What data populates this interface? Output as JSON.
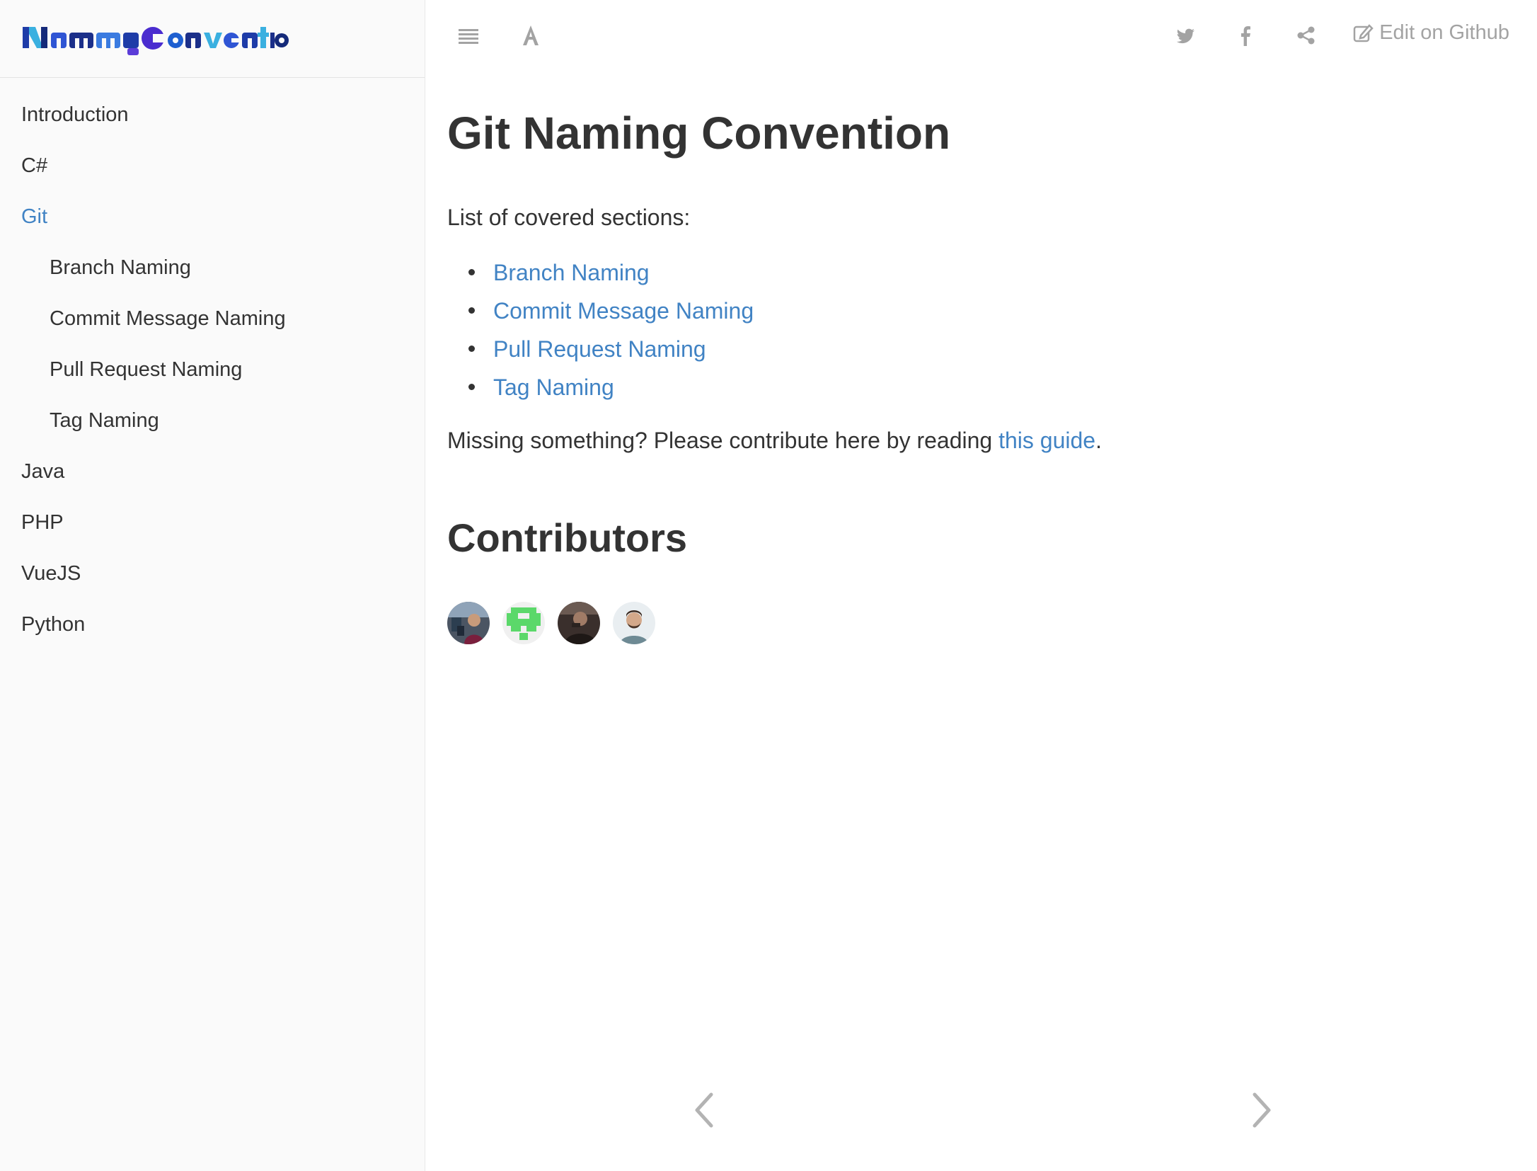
{
  "logo": {
    "text": "NamingConvention"
  },
  "sidebar": {
    "items": [
      {
        "label": "Introduction",
        "level": 0,
        "active": false
      },
      {
        "label": "C#",
        "level": 0,
        "active": false
      },
      {
        "label": "Git",
        "level": 0,
        "active": true
      },
      {
        "label": "Branch Naming",
        "level": 1,
        "active": false
      },
      {
        "label": "Commit Message Naming",
        "level": 1,
        "active": false
      },
      {
        "label": "Pull Request Naming",
        "level": 1,
        "active": false
      },
      {
        "label": "Tag Naming",
        "level": 1,
        "active": false
      },
      {
        "label": "Java",
        "level": 0,
        "active": false
      },
      {
        "label": "PHP",
        "level": 0,
        "active": false
      },
      {
        "label": "VueJS",
        "level": 0,
        "active": false
      },
      {
        "label": "Python",
        "level": 0,
        "active": false
      }
    ]
  },
  "header": {
    "icons": [
      "menu-icon",
      "font-settings-icon",
      "twitter-icon",
      "facebook-icon",
      "share-icon"
    ],
    "edit_label": "Edit on Github"
  },
  "main": {
    "title": "Git Naming Convention",
    "intro": "List of covered sections:",
    "sections": [
      "Branch Naming",
      "Commit Message Naming",
      "Pull Request Naming",
      "Tag Naming"
    ],
    "missing_prefix": "Missing something? Please contribute here by reading ",
    "missing_link": "this guide",
    "missing_suffix": ".",
    "contributors_title": "Contributors"
  },
  "colors": {
    "link": "#4183c4",
    "text": "#333333",
    "muted_icon": "#a3a3a3",
    "sidebar_bg": "#fafafa"
  }
}
